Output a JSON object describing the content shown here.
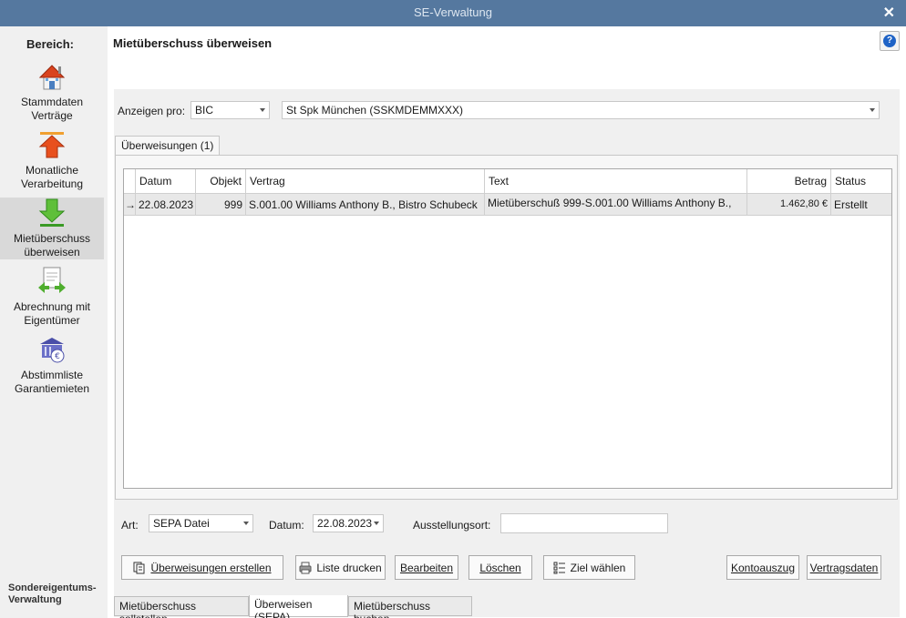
{
  "window": {
    "title": "SE-Verwaltung"
  },
  "sidebar": {
    "heading": "Bereich:",
    "items": [
      {
        "label_line1": "Stammdaten",
        "label_line2": "Verträge",
        "icon": "house-icon"
      },
      {
        "label_line1": "Monatliche",
        "label_line2": "Verarbeitung",
        "icon": "arrow-up-icon"
      },
      {
        "label_line1": "Mietüberschuss",
        "label_line2": "überweisen",
        "icon": "arrow-down-icon",
        "active": true
      },
      {
        "label_line1": "Abrechnung mit",
        "label_line2": "Eigentümer",
        "icon": "document-exchange-icon"
      },
      {
        "label_line1": "Abstimmliste",
        "label_line2": "Garantiemieten",
        "icon": "euro-bank-icon"
      }
    ],
    "footer_line1": "Sondereigentums-",
    "footer_line2": "Verwaltung"
  },
  "main": {
    "title": "Mietüberschuss überweisen",
    "help": "?"
  },
  "filter": {
    "label": "Anzeigen pro:",
    "type_value": "BIC",
    "bank_value": "St Spk München (SSKMDEMMXXX)"
  },
  "tab": {
    "label": "Überweisungen (1)"
  },
  "table": {
    "columns": [
      "Datum",
      "Objekt",
      "Vertrag",
      "Text",
      "Betrag",
      "Status"
    ],
    "rows": [
      {
        "marker": "→",
        "datum": "22.08.2023",
        "objekt": "999",
        "vertrag": "S.001.00 Williams Anthony B., Bistro Schubeck",
        "text": "Mietüberschuß  999-S.001.00 Williams Anthony B.,",
        "betrag": "1.462,80 €",
        "status": "Erstellt"
      }
    ]
  },
  "options": {
    "art_label": "Art:",
    "art_value": "SEPA Datei",
    "datum_label": "Datum:",
    "datum_value": "22.08.2023",
    "ort_label": "Ausstellungsort:",
    "ort_value": ""
  },
  "buttons": {
    "create": "Überweisungen erstellen",
    "print": "Liste drucken",
    "edit": "Bearbeiten",
    "delete": "Löschen",
    "target": "Ziel wählen",
    "statement": "Kontoauszug",
    "contract": "Vertragsdaten"
  },
  "bottom_tabs": [
    "Mietüberschuss sollstellen",
    "Überweisen (SEPA)",
    "Mietüberschuss buchen"
  ],
  "colors": {
    "titlebar": "#55789f",
    "sidebar": "#f0f0f0",
    "active_nav": "#d9d9d9",
    "selected_row": "#e8e8e8"
  }
}
